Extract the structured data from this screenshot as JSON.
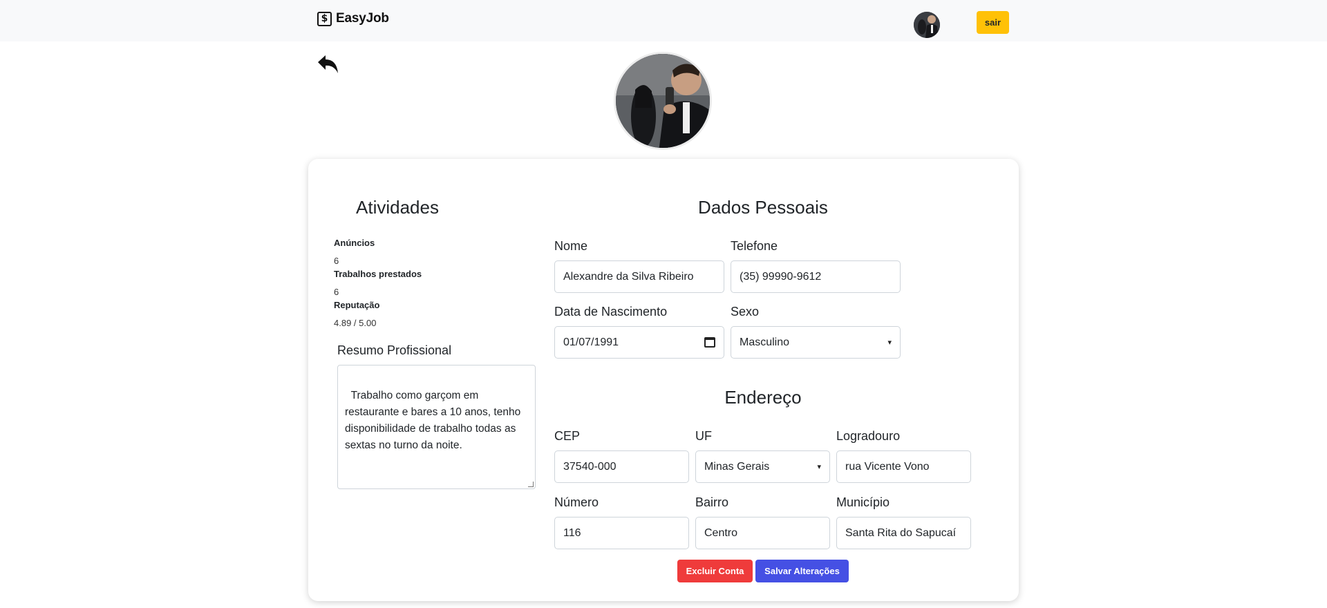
{
  "navbar": {
    "brand_icon": "$",
    "brand_name": "EasyJob",
    "logout_label": "sair"
  },
  "icons": {
    "brand": "dollar-square-icon",
    "back": "reply-arrow-icon",
    "calendar": "calendar-icon",
    "dropdown": "chevron-down-icon"
  },
  "activities": {
    "title": "Atividades",
    "stats": [
      {
        "label": "Anúncios",
        "value": "6"
      },
      {
        "label": "Trabalhos prestados",
        "value": "6"
      },
      {
        "label": "Reputação",
        "value": "4.89 / 5.00"
      }
    ],
    "summary_label": "Resumo Profissional",
    "summary_text": "Trabalho como garçom em\nrestaurante e bares a 10 anos, tenho\ndisponibilidade de trabalho todas as\nsextas no turno da noite."
  },
  "personal": {
    "title": "Dados Pessoais",
    "name_label": "Nome",
    "name_value": "Alexandre da Silva Ribeiro",
    "phone_label": "Telefone",
    "phone_value": "(35) 99990-9612",
    "birth_label": "Data de Nascimento",
    "birth_value": "01/07/1991",
    "sex_label": "Sexo",
    "sex_value": "Masculino"
  },
  "address": {
    "title": "Endereço",
    "cep_label": "CEP",
    "cep_value": "37540-000",
    "uf_label": "UF",
    "uf_value": "Minas Gerais",
    "street_label": "Logradouro",
    "street_value": "rua Vicente Vono",
    "number_label": "Número",
    "number_value": "116",
    "district_label": "Bairro",
    "district_value": "Centro",
    "city_label": "Município",
    "city_value": "Santa Rita do Sapucaí"
  },
  "actions": {
    "delete_label": "Excluir Conta",
    "save_label": "Salvar Alterações"
  },
  "colors": {
    "navbar_bg": "#f8f9fa",
    "warning": "#ffc107",
    "danger": "#ef3b3b",
    "primary": "#4550e4"
  }
}
